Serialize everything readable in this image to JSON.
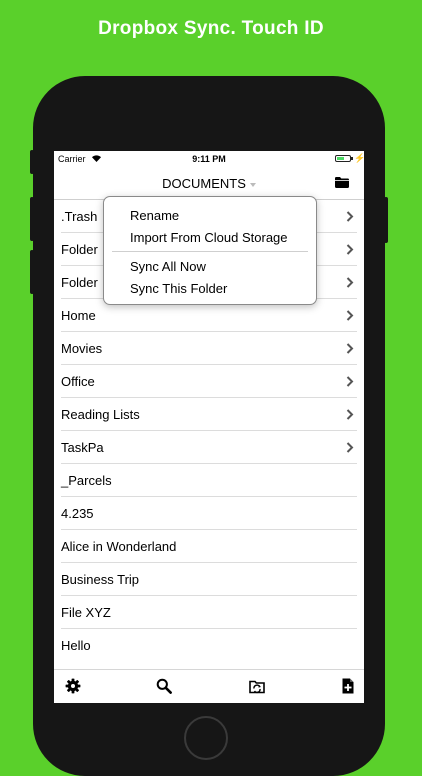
{
  "headline": "Dropbox Sync. Touch ID",
  "status": {
    "carrier": "Carrier",
    "time": "9:11 PM"
  },
  "nav": {
    "title": "DOCUMENTS"
  },
  "menu": {
    "items": [
      "Rename",
      "Import From Cloud Storage",
      "Sync All Now",
      "Sync This Folder"
    ]
  },
  "list": [
    {
      "label": ".Trash",
      "chevron": true
    },
    {
      "label": "Folder",
      "chevron": true
    },
    {
      "label": "Folder",
      "chevron": true
    },
    {
      "label": "Home",
      "chevron": true
    },
    {
      "label": "Movies",
      "chevron": true
    },
    {
      "label": "Office",
      "chevron": true
    },
    {
      "label": "Reading Lists",
      "chevron": true
    },
    {
      "label": "TaskPa",
      "chevron": true
    },
    {
      "label": "_Parcels",
      "chevron": false
    },
    {
      "label": "4.235",
      "chevron": false
    },
    {
      "label": "Alice in Wonderland",
      "chevron": false
    },
    {
      "label": "Business Trip",
      "chevron": false
    },
    {
      "label": "File XYZ",
      "chevron": false
    },
    {
      "label": "Hello",
      "chevron": false
    }
  ],
  "toolbar": {
    "icons": [
      "gear-icon",
      "search-icon",
      "folder-sync-icon",
      "new-document-icon"
    ]
  },
  "colors": {
    "background": "#5ad02b",
    "phone": "#161616"
  }
}
